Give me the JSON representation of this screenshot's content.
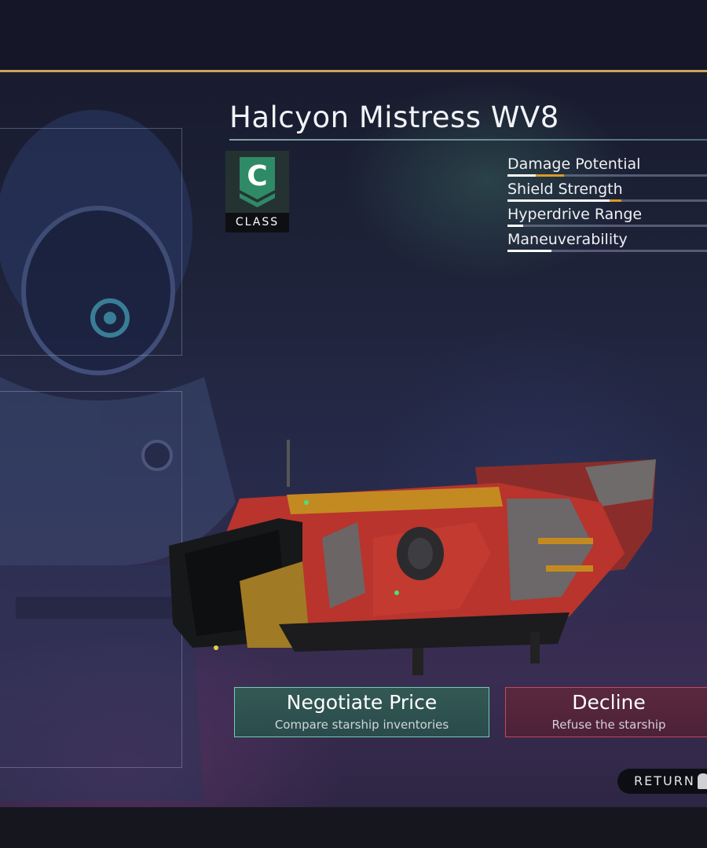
{
  "ship": {
    "name": "Halcyon Mistress WV8",
    "class_letter": "C",
    "class_label": "CLASS"
  },
  "stats": [
    {
      "label": "Damage Potential",
      "level": 0.14,
      "boost": 0.14
    },
    {
      "label": "Shield Strength",
      "level": 0.51,
      "boost": 0.06
    },
    {
      "label": "Hyperdrive Range",
      "level": 0.08,
      "boost": 0
    },
    {
      "label": "Maneuverability",
      "level": 0.22,
      "boost": 0
    }
  ],
  "actions": {
    "negotiate": {
      "title": "Negotiate Price",
      "subtitle": "Compare starship inventories"
    },
    "decline": {
      "title": "Decline",
      "subtitle": "Refuse the starship"
    }
  },
  "return_label": "RETURN",
  "colors": {
    "accent_gold": "#c9a55a",
    "negotiate_border": "#6fcfb0",
    "decline_border": "#c8485a",
    "stat_boost": "#d89b2a"
  }
}
